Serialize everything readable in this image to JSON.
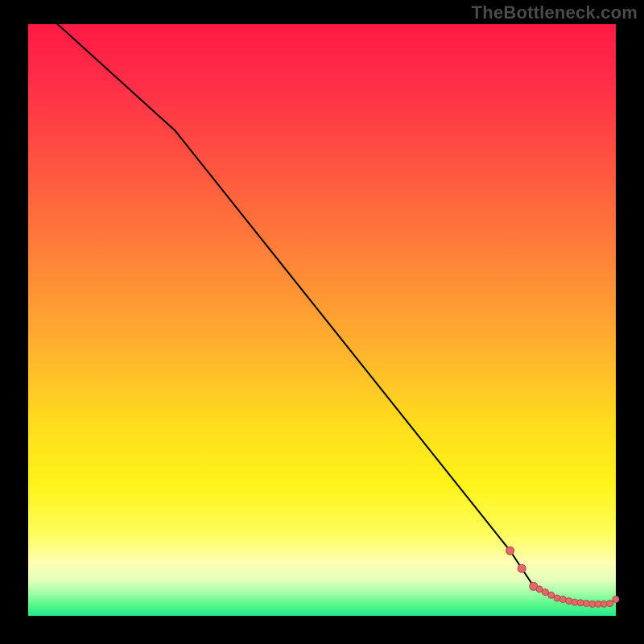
{
  "watermark": "TheBottleneck.com",
  "chart_data": {
    "type": "line",
    "title": "",
    "xlabel": "",
    "ylabel": "",
    "xlim": [
      0,
      100
    ],
    "ylim": [
      0,
      100
    ],
    "grid": false,
    "series": [
      {
        "name": "bottleneck-curve",
        "x": [
          5,
          25,
          82,
          86,
          88,
          90,
          92,
          93,
          94,
          95,
          97,
          99,
          100
        ],
        "y": [
          100,
          82,
          11,
          5,
          4,
          3,
          2.5,
          2.3,
          2.2,
          2.1,
          2,
          2.1,
          2.8
        ]
      }
    ],
    "markers": {
      "name": "highlight-markers",
      "x": [
        82,
        84,
        86,
        87,
        88,
        89,
        90,
        91,
        92,
        93,
        94,
        95,
        96,
        97,
        98,
        99,
        100
      ],
      "y": [
        11,
        8,
        5,
        4.5,
        4,
        3.5,
        3,
        2.8,
        2.5,
        2.3,
        2.2,
        2.1,
        2,
        2,
        2,
        2.1,
        2.8
      ]
    },
    "gradient_stops": [
      {
        "pos": 0,
        "color": "#ff1a45"
      },
      {
        "pos": 25,
        "color": "#ff5740"
      },
      {
        "pos": 55,
        "color": "#ffb22e"
      },
      {
        "pos": 78,
        "color": "#fff31a"
      },
      {
        "pos": 94,
        "color": "#e3ffba"
      },
      {
        "pos": 100,
        "color": "#22e98c"
      }
    ]
  }
}
